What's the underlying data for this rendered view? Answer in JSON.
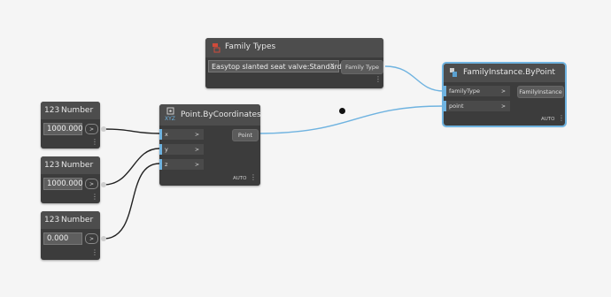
{
  "nodes": {
    "family_types": {
      "title": "Family Types",
      "dropdown_value": "Easytop slanted seat valve:Standard",
      "output_label": "Family Type"
    },
    "family_instance": {
      "title": "FamilyInstance.ByPoint",
      "inputs": [
        "familyType",
        "point"
      ],
      "output_label": "FamilyInstance",
      "lacing": "AUTO"
    },
    "point_by_coords": {
      "icon_text": "XYZ",
      "title": "Point.ByCoordinates",
      "inputs": [
        "x",
        "y",
        "z"
      ],
      "output_label": "Point",
      "lacing": "AUTO"
    },
    "number_1": {
      "icon_text": "123",
      "title": "Number",
      "value": "1000.000"
    },
    "number_2": {
      "icon_text": "123",
      "title": "Number",
      "value": "1000.000"
    },
    "number_3": {
      "icon_text": "123",
      "title": "Number",
      "value": "0.000"
    }
  },
  "glyphs": {
    "port_arrow": ">",
    "menu": "⋮",
    "dropdown_chevron": "⌄"
  },
  "colors": {
    "wire_selected": "#6fb3e0",
    "wire_default": "#222222",
    "background": "#f5f5f5",
    "node_body": "#3c3c3c"
  }
}
